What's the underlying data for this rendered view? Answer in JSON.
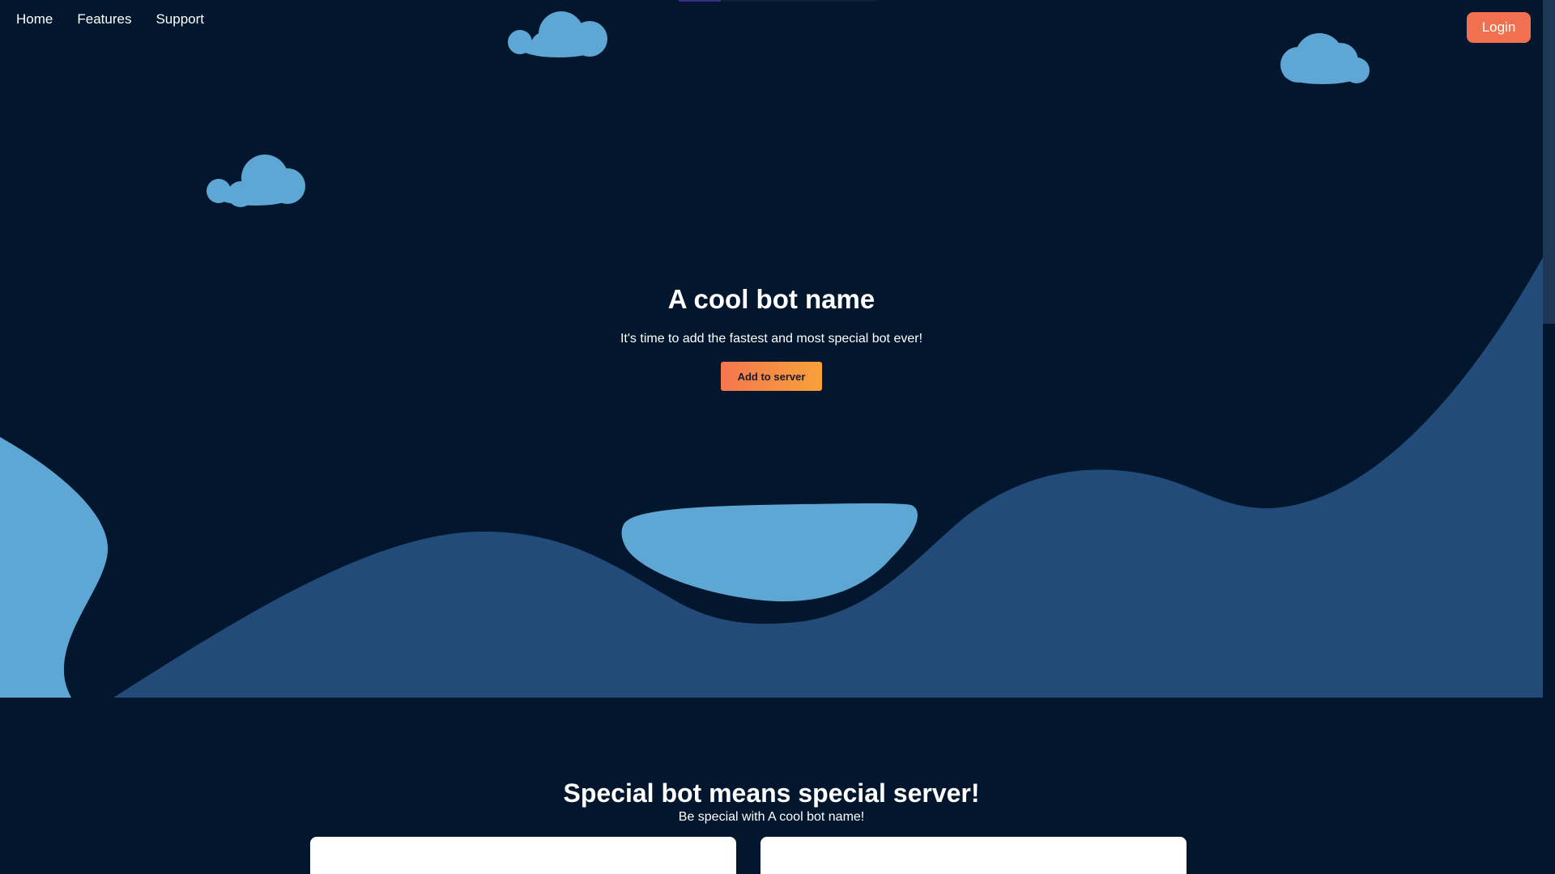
{
  "nav": {
    "links": [
      "Home",
      "Features",
      "Support"
    ],
    "login_label": "Login"
  },
  "hero": {
    "title": "A cool bot name",
    "subtitle": "It's time to add the fastest and most special bot ever!",
    "cta_label": "Add to server"
  },
  "features": {
    "title": "Special bot means special server!",
    "subtitle": "Be special with A cool bot name!"
  },
  "colors": {
    "background": "#02172e",
    "hills": "#224b7a",
    "clouds": "#5ea6d4",
    "accent": "#f0704f",
    "cta_gradient_start": "#f5774f",
    "cta_gradient_end": "#f7a13a",
    "card": "#ffffff"
  },
  "icons": {
    "decorations": [
      "cloud-icon",
      "cloud-icon",
      "cloud-icon"
    ]
  }
}
